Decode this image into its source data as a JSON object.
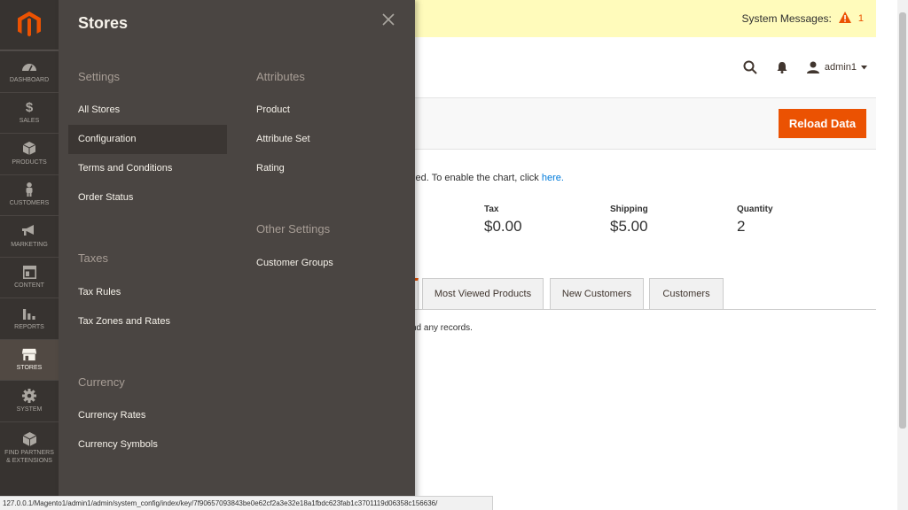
{
  "system_messages": {
    "label": "System Messages:",
    "count": "1"
  },
  "header": {
    "user_name": "admin1"
  },
  "action_bar": {
    "reload_label": "Reload Data"
  },
  "dashboard": {
    "chart_note": "bled. To enable the chart, click ",
    "chart_link": "here.",
    "stats": [
      {
        "label": "Tax",
        "value": "$0.00"
      },
      {
        "label": "Shipping",
        "value": "$5.00"
      },
      {
        "label": "Quantity",
        "value": "2"
      }
    ],
    "tabs": [
      "Most Viewed Products",
      "New Customers",
      "Customers"
    ],
    "records_note": "nd any records."
  },
  "nav": {
    "items": [
      {
        "label": "Dashboard",
        "icon": "dashboard-icon"
      },
      {
        "label": "Sales",
        "icon": "dollar-icon"
      },
      {
        "label": "Products",
        "icon": "box-icon"
      },
      {
        "label": "Customers",
        "icon": "person-icon"
      },
      {
        "label": "Marketing",
        "icon": "megaphone-icon"
      },
      {
        "label": "Content",
        "icon": "layout-icon"
      },
      {
        "label": "Reports",
        "icon": "bar-chart-icon"
      },
      {
        "label": "Stores",
        "icon": "storefront-icon"
      },
      {
        "label": "System",
        "icon": "gear-icon"
      },
      {
        "label": "Find Partners & Extensions",
        "icon": "cube-icon"
      }
    ]
  },
  "panel": {
    "title": "Stores",
    "settings": {
      "heading": "Settings",
      "links": [
        "All Stores",
        "Configuration",
        "Terms and Conditions",
        "Order Status"
      ]
    },
    "taxes": {
      "heading": "Taxes",
      "links": [
        "Tax Rules",
        "Tax Zones and Rates"
      ]
    },
    "currency": {
      "heading": "Currency",
      "links": [
        "Currency Rates",
        "Currency Symbols"
      ]
    },
    "attributes": {
      "heading": "Attributes",
      "links": [
        "Product",
        "Attribute Set",
        "Rating"
      ]
    },
    "other_settings": {
      "heading": "Other Settings",
      "links": [
        "Customer Groups"
      ]
    }
  },
  "status_url": "127.0.0.1/Magento1/admin1/admin/system_config/index/key/7f90657093843be0e62cf2a3e32e18a1fbdc623fab1c3701119d06358c156636/",
  "colors": {
    "accent": "#eb5202",
    "nav_bg": "#373330",
    "panel_bg": "#4a4542",
    "link": "#007bdb"
  }
}
